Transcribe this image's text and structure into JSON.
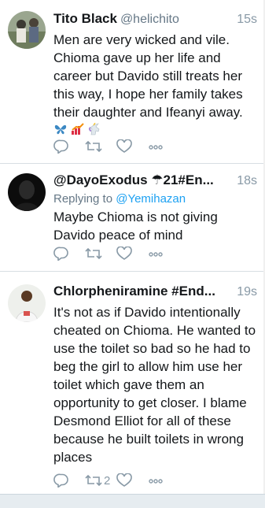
{
  "tweets": [
    {
      "name": "Tito Black",
      "handle": "@helichito",
      "time": "15s",
      "text": "Men are very wicked and vile. Chioma gave up her life and career but Davido still treats her this way, I hope her family takes their daughter and Ifeanyi away.",
      "emoji_icons": [
        "butterfly-emoji",
        "chart-emoji",
        "unicorn-emoji"
      ],
      "retweet_count": ""
    },
    {
      "name": "@DayoExodus ☂21#En...",
      "time": "18s",
      "replying_label": "Replying to",
      "replying_to": "@Yemihazan",
      "text": "Maybe Chioma is not giving Davido peace of mind",
      "retweet_count": ""
    },
    {
      "name": "Chlorpheniramine #End...",
      "time": "19s",
      "text": "It's not as if Davido intentionally cheated on Chioma. He wanted to use the toilet so bad so he had to beg the girl to allow him use her toilet which gave them an opportunity to get closer. I blame Desmond Elliot for all of these because he built toilets in wrong places",
      "retweet_count": "2"
    }
  ],
  "icons": {
    "reply": "reply-icon",
    "retweet": "retweet-icon",
    "like": "heart-icon",
    "more": "more-dots-icon"
  },
  "colors": {
    "text": "#14171a",
    "secondary": "#657786",
    "icon": "#8899a6",
    "link": "#1da1f2",
    "divider": "#d8dee3"
  }
}
